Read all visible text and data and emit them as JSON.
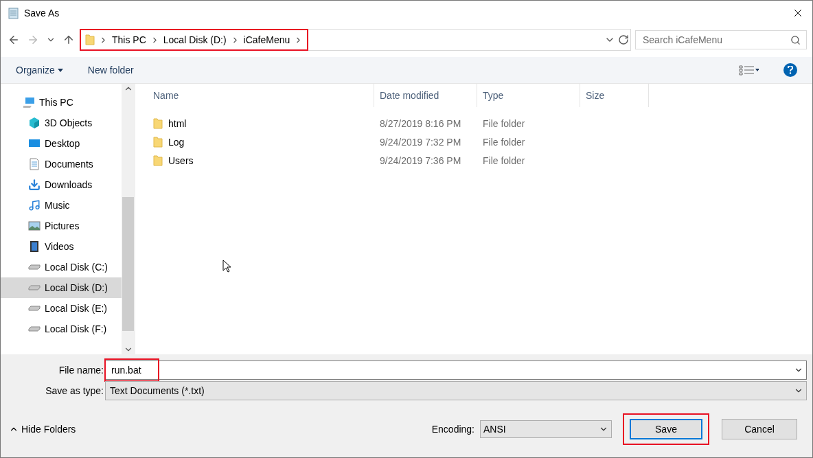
{
  "window": {
    "title": "Save As"
  },
  "breadcrumb": [
    "This PC",
    "Local Disk (D:)",
    "iCafeMenu"
  ],
  "search": {
    "placeholder": "Search iCafeMenu"
  },
  "toolbar": {
    "organize": "Organize",
    "new_folder": "New folder"
  },
  "sidebar": {
    "items": [
      {
        "label": "This PC",
        "kind": "pc",
        "selected": false,
        "children": [
          {
            "label": "3D Objects",
            "kind": "cube",
            "selected": false
          },
          {
            "label": "Desktop",
            "kind": "desktop",
            "selected": false
          },
          {
            "label": "Documents",
            "kind": "document",
            "selected": false
          },
          {
            "label": "Downloads",
            "kind": "download",
            "selected": false
          },
          {
            "label": "Music",
            "kind": "music",
            "selected": false
          },
          {
            "label": "Pictures",
            "kind": "picture",
            "selected": false
          },
          {
            "label": "Videos",
            "kind": "video",
            "selected": false
          },
          {
            "label": "Local Disk (C:)",
            "kind": "drive",
            "selected": false
          },
          {
            "label": "Local Disk (D:)",
            "kind": "drive",
            "selected": true
          },
          {
            "label": "Local Disk (E:)",
            "kind": "drive",
            "selected": false
          },
          {
            "label": "Local Disk (F:)",
            "kind": "drive",
            "selected": false
          }
        ]
      }
    ]
  },
  "table": {
    "columns": [
      "Name",
      "Date modified",
      "Type",
      "Size"
    ],
    "rows": [
      {
        "name": "html",
        "date": "8/27/2019 8:16 PM",
        "type": "File folder"
      },
      {
        "name": "Log",
        "date": "9/24/2019 7:32 PM",
        "type": "File folder"
      },
      {
        "name": "Users",
        "date": "9/24/2019 7:36 PM",
        "type": "File folder"
      }
    ]
  },
  "form": {
    "file_name_label": "File name:",
    "file_name": "run.bat",
    "type_label": "Save as type:",
    "type": "Text Documents (*.txt)",
    "encoding_label": "Encoding:",
    "encoding": "ANSI"
  },
  "hide_folders": "Hide Folders",
  "buttons": [
    "Save",
    "Cancel"
  ]
}
